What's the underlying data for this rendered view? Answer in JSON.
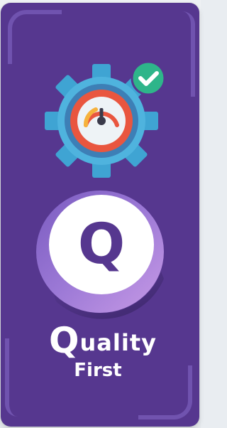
{
  "badge": {
    "title_initial": "Q",
    "title_rest": "uality",
    "subtitle": "First",
    "medal_letter": "Q",
    "gear_icon": "gear-gauge-icon",
    "check_icon": "check-icon"
  },
  "colors": {
    "card_bg": "#56378f",
    "accent_purple": "#7457b3",
    "gear_blue": "#4fb3de",
    "gauge_red": "#e9563f",
    "check_green": "#2eb58a"
  }
}
